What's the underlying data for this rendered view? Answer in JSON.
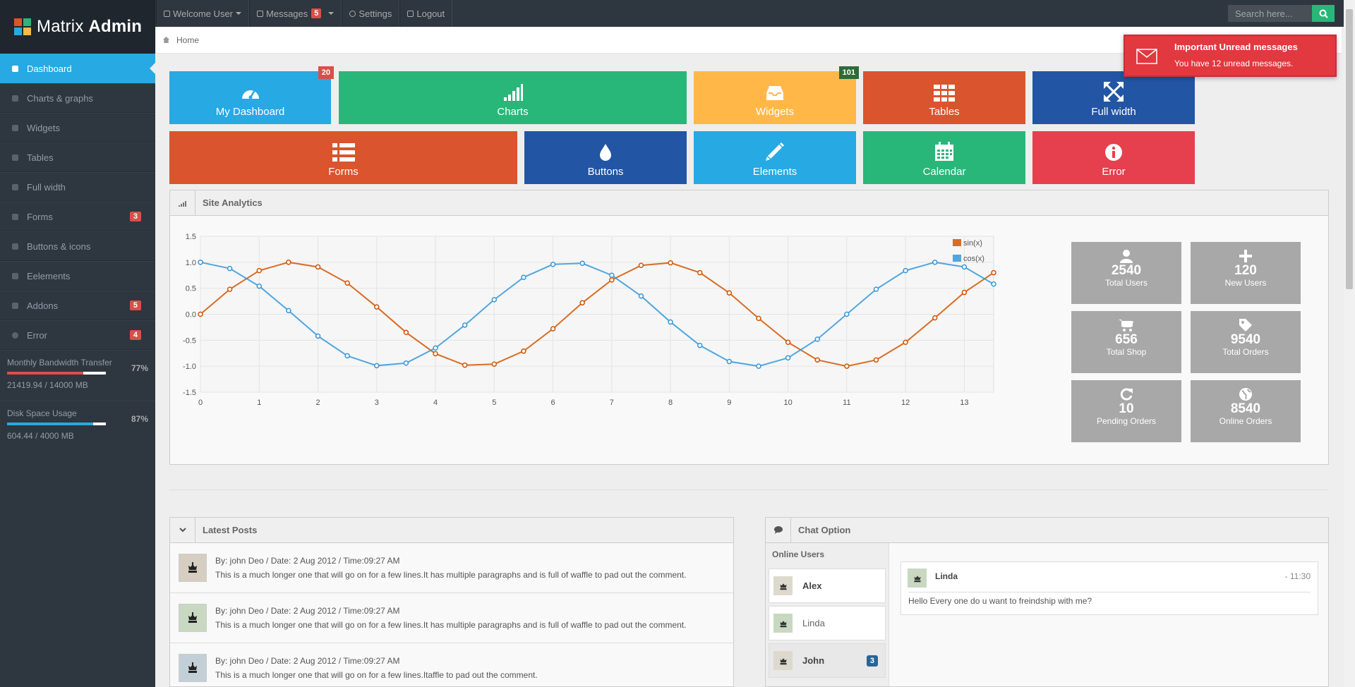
{
  "brand": {
    "name_light": "Matrix",
    "name_bold": "Admin"
  },
  "topnav": {
    "welcome": "Welcome User",
    "messages": "Messages",
    "messages_count": "5",
    "settings": "Settings",
    "logout": "Logout"
  },
  "search": {
    "placeholder": "Search here..."
  },
  "breadcrumb": {
    "home": "Home"
  },
  "sidebar": {
    "items": [
      {
        "label": "Dashboard",
        "icon": "home-icon"
      },
      {
        "label": "Charts &amp; graphs"
      },
      {
        "label": "Widgets"
      },
      {
        "label": "Tables"
      },
      {
        "label": "Full width"
      },
      {
        "label": "Forms",
        "count": "3"
      },
      {
        "label": "Buttons & icons"
      },
      {
        "label": "Eelements"
      },
      {
        "label": "Addons",
        "count": "5"
      },
      {
        "label": "Error",
        "count": "4"
      }
    ],
    "bandwidth": {
      "label": "Monthly Bandwidth Transfer",
      "value": "21419.94 / 14000 MB",
      "percent": "77%"
    },
    "disk": {
      "label": "Disk Space Usage",
      "value": "604.44 / 4000 MB",
      "percent": "87%"
    }
  },
  "tiles": [
    {
      "label": "My Dashboard",
      "badge": "20",
      "color": "#27a9e3"
    },
    {
      "label": "Charts",
      "color": "#28b779"
    },
    {
      "label": "Widgets",
      "badge": "101",
      "color": "#ffb848"
    },
    {
      "label": "Tables",
      "color": "#da542e"
    },
    {
      "label": "Full width",
      "color": "#2255a4"
    },
    {
      "label": "Forms",
      "color": "#da542e"
    },
    {
      "label": "Buttons",
      "color": "#2255a4"
    },
    {
      "label": "Elements",
      "color": "#27a9e3"
    },
    {
      "label": "Calendar",
      "color": "#28b779"
    },
    {
      "label": "Error",
      "color": "#e63f4d"
    }
  ],
  "analytics": {
    "title": "Site Analytics",
    "stats": [
      {
        "num": "2540",
        "label": "Total Users",
        "icon": "user-icon"
      },
      {
        "num": "120",
        "label": "New Users",
        "icon": "plus-icon"
      },
      {
        "num": "656",
        "label": "Total Shop",
        "icon": "cart-icon"
      },
      {
        "num": "9540",
        "label": "Total Orders",
        "icon": "tag-icon"
      },
      {
        "num": "10",
        "label": "Pending Orders",
        "icon": "refresh-icon"
      },
      {
        "num": "8540",
        "label": "Online Orders",
        "icon": "globe-icon"
      }
    ]
  },
  "chart_data": {
    "type": "line",
    "title": "",
    "xlabel": "",
    "ylabel": "",
    "xlim": [
      0,
      13.5
    ],
    "ylim": [
      -1.5,
      1.5
    ],
    "x_ticks": [
      0,
      1,
      2,
      3,
      4,
      5,
      6,
      7,
      8,
      9,
      10,
      11,
      12,
      13
    ],
    "y_ticks": [
      1.5,
      1.0,
      0.5,
      0.0,
      -0.5,
      -1.0,
      -1.5
    ],
    "y_tick_labels": [
      "1.5",
      "1.0",
      "0.5",
      "0.0",
      "-0.5",
      "-1.0",
      "-1.5"
    ],
    "legend_position": "top-right",
    "grid": true,
    "x": [
      0,
      0.5,
      1,
      1.5,
      2,
      2.5,
      3,
      3.5,
      4,
      4.5,
      5,
      5.5,
      6,
      6.5,
      7,
      7.5,
      8,
      8.5,
      9,
      9.5,
      10,
      10.5,
      11,
      11.5,
      12,
      12.5,
      13,
      13.5
    ],
    "series": [
      {
        "name": "sin(x)",
        "color": "#d35400",
        "values": [
          0.0,
          0.48,
          0.84,
          1.0,
          0.91,
          0.6,
          0.14,
          -0.35,
          -0.76,
          -0.98,
          -0.96,
          -0.71,
          -0.28,
          0.22,
          0.66,
          0.94,
          0.99,
          0.8,
          0.41,
          -0.08,
          -0.54,
          -0.88,
          -1.0,
          -0.88,
          -0.54,
          -0.07,
          0.42,
          0.8
        ]
      },
      {
        "name": "cos(x)",
        "color": "#3498db",
        "values": [
          1.0,
          0.88,
          0.54,
          0.07,
          -0.42,
          -0.8,
          -0.99,
          -0.94,
          -0.65,
          -0.21,
          0.28,
          0.71,
          0.96,
          0.98,
          0.75,
          0.35,
          -0.15,
          -0.6,
          -0.91,
          -1.0,
          -0.84,
          -0.48,
          0.0,
          0.48,
          0.84,
          1.0,
          0.91,
          0.58
        ]
      }
    ]
  },
  "posts": {
    "title": "Latest Posts",
    "items": [
      {
        "meta": "By: john Deo / Date: 2 Aug 2012 / Time:09:27 AM",
        "text": "This is a much longer one that will go on for a few lines.It has multiple paragraphs and is full of waffle to pad out the comment."
      },
      {
        "meta": "By: john Deo / Date: 2 Aug 2012 / Time:09:27 AM",
        "text": "This is a much longer one that will go on for a few lines.It has multiple paragraphs and is full of waffle to pad out the comment."
      },
      {
        "meta": "By: john Deo / Date: 2 Aug 2012 / Time:09:27 AM",
        "text": "This is a much longer one that will go on for a few lines.Itaffle to pad out the comment."
      }
    ]
  },
  "chat": {
    "title": "Chat Option",
    "online_title": "Online Users",
    "users": [
      {
        "name": "Alex"
      },
      {
        "name": "Linda"
      },
      {
        "name": "John",
        "count": "3"
      }
    ],
    "message": {
      "author": "Linda",
      "time": "- 11:30",
      "text": "Hello Every one do u want to freindship with me?"
    }
  },
  "notification": {
    "title": "Important Unread messages",
    "text": "You have 12 unread messages."
  }
}
